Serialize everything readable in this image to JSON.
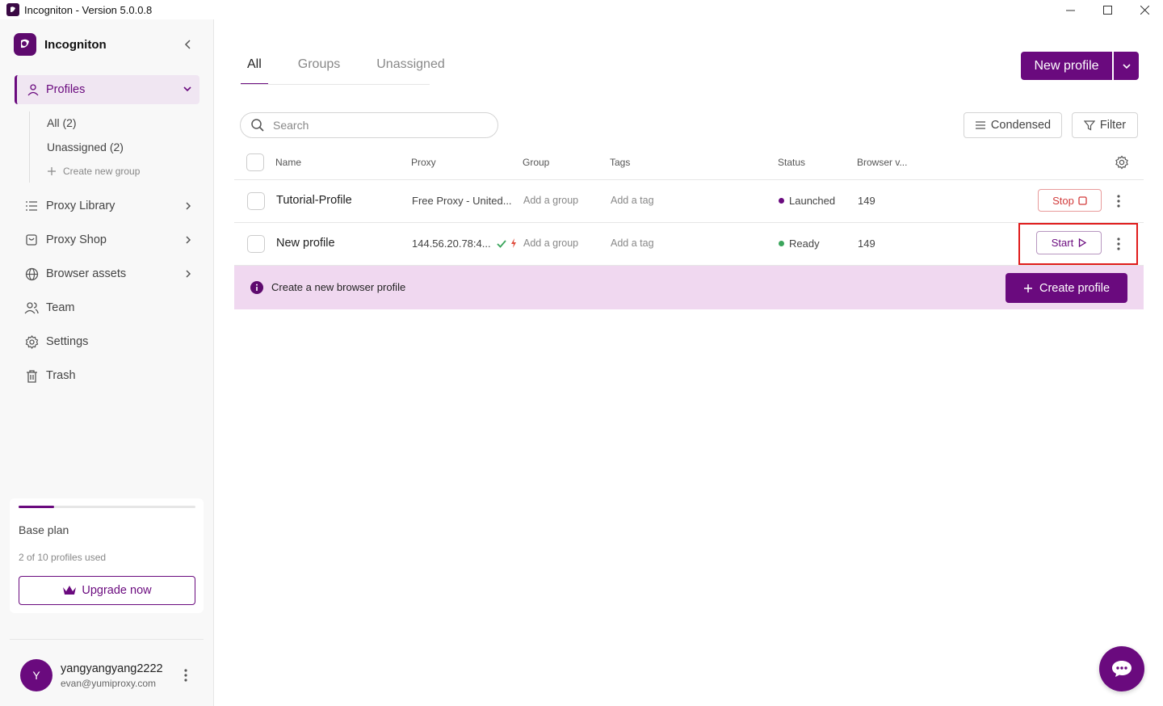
{
  "window": {
    "title": "Incogniton - Version 5.0.0.8"
  },
  "brand": {
    "name": "Incogniton"
  },
  "sidebar": {
    "active": {
      "label": "Profiles"
    },
    "sub_items": [
      {
        "label": "All (2)"
      },
      {
        "label": "Unassigned (2)"
      }
    ],
    "create_group": "Create new group",
    "items": [
      {
        "label": "Proxy Library",
        "icon": "list-icon",
        "has_chevron": true
      },
      {
        "label": "Proxy Shop",
        "icon": "shop-icon",
        "has_chevron": true
      },
      {
        "label": "Browser assets",
        "icon": "globe-icon",
        "has_chevron": true
      },
      {
        "label": "Team",
        "icon": "team-icon",
        "has_chevron": false
      },
      {
        "label": "Settings",
        "icon": "gear-icon",
        "has_chevron": false
      },
      {
        "label": "Trash",
        "icon": "trash-icon",
        "has_chevron": false
      }
    ],
    "plan": {
      "name": "Base plan",
      "usage": "2 of 10 profiles used",
      "used_fraction": 0.2,
      "upgrade_label": "Upgrade now"
    },
    "user": {
      "initial": "Y",
      "name": "yangyangyang2222",
      "email": "evan@yumiproxy.com"
    }
  },
  "main": {
    "tabs": [
      {
        "label": "All"
      },
      {
        "label": "Groups"
      },
      {
        "label": "Unassigned"
      }
    ],
    "new_profile_label": "New profile",
    "search_placeholder": "Search",
    "condensed_label": "Condensed",
    "filter_label": "Filter",
    "columns": [
      "Name",
      "Proxy",
      "Group",
      "Tags",
      "Status",
      "Browser v..."
    ],
    "rows": [
      {
        "name": "Tutorial-Profile",
        "proxy": "Free Proxy - United...",
        "group": "Add a group",
        "tags": "Add a tag",
        "status": "Launched",
        "status_color": "#6a0a7e",
        "browser": "149",
        "action": "Stop"
      },
      {
        "name": "New profile",
        "proxy": "144.56.20.78:4...",
        "group": "Add a group",
        "tags": "Add a tag",
        "status": "Ready",
        "status_color": "#3ba55c",
        "browser": "149",
        "action": "Start"
      }
    ],
    "banner": {
      "text": "Create a new browser profile",
      "button": "Create profile"
    }
  },
  "colors": {
    "accent": "#6a0a7e",
    "danger": "#d23b3b",
    "success": "#3ba55c",
    "highlight": "#e01b1b"
  }
}
